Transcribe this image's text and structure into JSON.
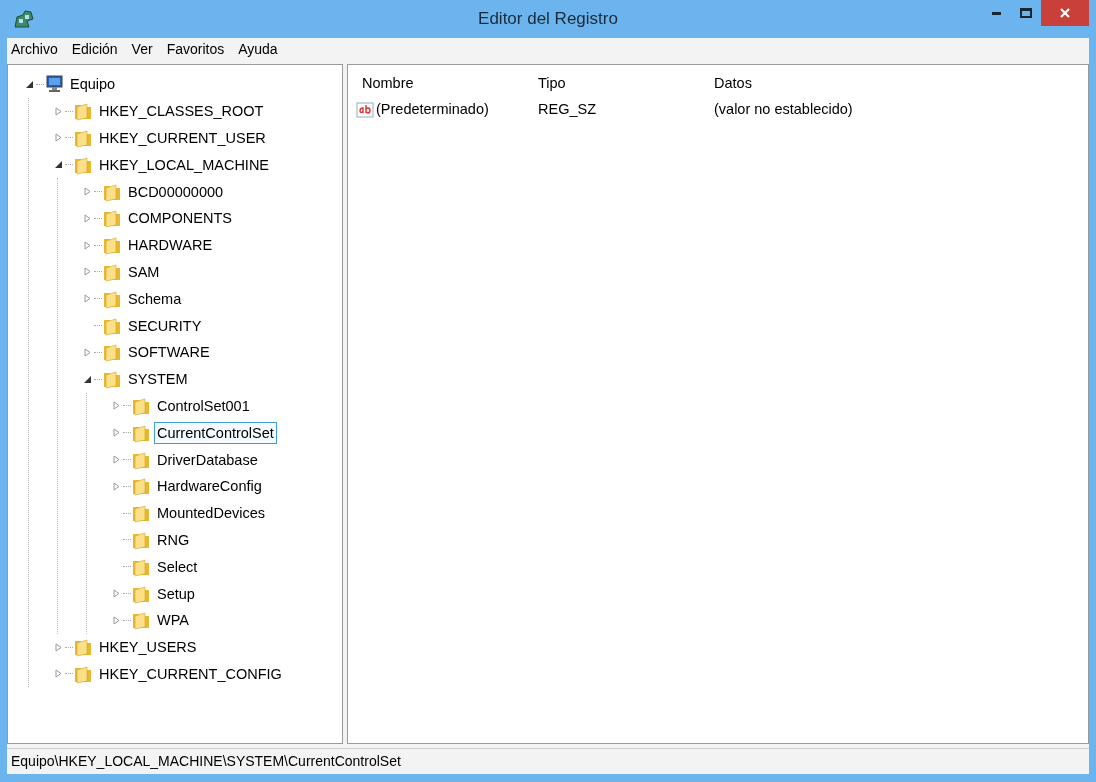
{
  "window": {
    "title": "Editor del Registro"
  },
  "menu": [
    "Archivo",
    "Edición",
    "Ver",
    "Favoritos",
    "Ayuda"
  ],
  "tree": [
    {
      "label": "Equipo",
      "kind": "computer",
      "expanded": true,
      "selected": false,
      "children": [
        {
          "label": "HKEY_CLASSES_ROOT",
          "kind": "branch",
          "expanded": false,
          "selected": false
        },
        {
          "label": "HKEY_CURRENT_USER",
          "kind": "branch",
          "expanded": false,
          "selected": false
        },
        {
          "label": "HKEY_LOCAL_MACHINE",
          "kind": "branch",
          "expanded": true,
          "selected": false,
          "children": [
            {
              "label": "BCD00000000",
              "kind": "branch",
              "expanded": false,
              "selected": false
            },
            {
              "label": "COMPONENTS",
              "kind": "branch",
              "expanded": false,
              "selected": false
            },
            {
              "label": "HARDWARE",
              "kind": "branch",
              "expanded": false,
              "selected": false
            },
            {
              "label": "SAM",
              "kind": "branch",
              "expanded": false,
              "selected": false
            },
            {
              "label": "Schema",
              "kind": "branch",
              "expanded": false,
              "selected": false
            },
            {
              "label": "SECURITY",
              "kind": "leaf",
              "selected": false
            },
            {
              "label": "SOFTWARE",
              "kind": "branch",
              "expanded": false,
              "selected": false
            },
            {
              "label": "SYSTEM",
              "kind": "branch",
              "expanded": true,
              "selected": false,
              "children": [
                {
                  "label": "ControlSet001",
                  "kind": "branch",
                  "expanded": false,
                  "selected": false
                },
                {
                  "label": "CurrentControlSet",
                  "kind": "branch",
                  "expanded": false,
                  "selected": true
                },
                {
                  "label": "DriverDatabase",
                  "kind": "branch",
                  "expanded": false,
                  "selected": false
                },
                {
                  "label": "HardwareConfig",
                  "kind": "branch",
                  "expanded": false,
                  "selected": false
                },
                {
                  "label": "MountedDevices",
                  "kind": "leaf",
                  "selected": false
                },
                {
                  "label": "RNG",
                  "kind": "leaf",
                  "selected": false
                },
                {
                  "label": "Select",
                  "kind": "leaf",
                  "selected": false
                },
                {
                  "label": "Setup",
                  "kind": "branch",
                  "expanded": false,
                  "selected": false
                },
                {
                  "label": "WPA",
                  "kind": "branch",
                  "expanded": false,
                  "selected": false
                }
              ]
            }
          ]
        },
        {
          "label": "HKEY_USERS",
          "kind": "branch",
          "expanded": false,
          "selected": false
        },
        {
          "label": "HKEY_CURRENT_CONFIG",
          "kind": "branch",
          "expanded": false,
          "selected": false
        }
      ]
    }
  ],
  "list": {
    "columns": [
      "Nombre",
      "Tipo",
      "Datos"
    ],
    "rows": [
      [
        "(Predeterminado)",
        "REG_SZ",
        "(valor no establecido)"
      ]
    ]
  },
  "status_bar": "Equipo\\HKEY_LOCAL_MACHINE\\SYSTEM\\CurrentControlSet"
}
